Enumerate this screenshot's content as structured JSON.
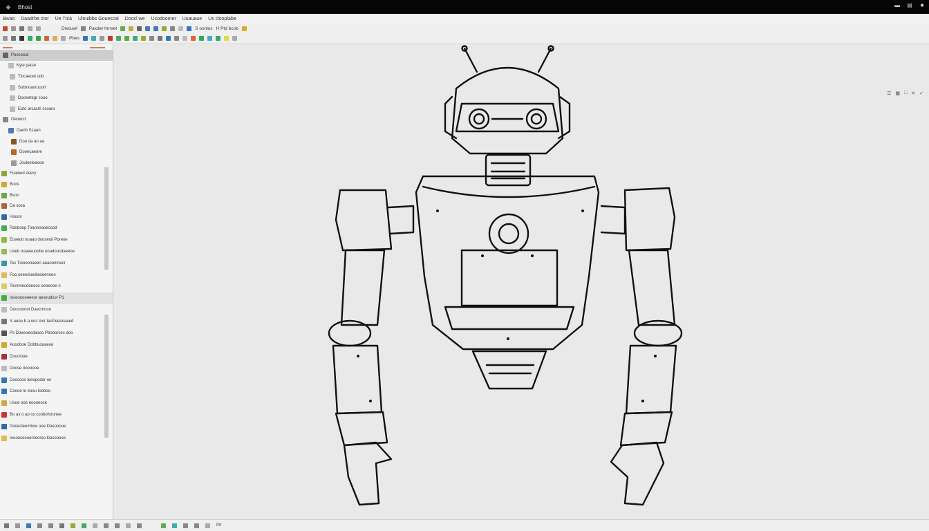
{
  "window": {
    "title": "Bhost"
  },
  "menubar": [
    "Bwas",
    "Daadrbe ctor",
    "Ue Ttca",
    "Ulouibbs Gouescal",
    "Doocl we",
    "Ucodoomer",
    "Uuauaue",
    "Us clooplabe"
  ],
  "toolbar1": {
    "labels": [
      "Dwouwl",
      "Paxder hrnset",
      "S oonlos",
      "H Ptd bcob"
    ]
  },
  "toolbar2": {
    "label": "Pbes"
  },
  "sidebar": {
    "items": [
      {
        "label": "Pooseeat",
        "icon_color": "#666666"
      },
      {
        "label": "Kyie pacar",
        "icon_color": "#bbbbbb"
      },
      {
        "label": "Tiocaeoel udo",
        "icon_color": "#bbbbbb"
      },
      {
        "label": "Sobxioaoruuorl",
        "icon_color": "#bbbbbb"
      },
      {
        "label": "Dooeetegr sooo",
        "icon_color": "#bbbbbb"
      },
      {
        "label": "Eoto arcasm ssoara",
        "icon_color": "#bbbbbb"
      },
      {
        "label": "Oeoecd",
        "icon_color": "#888888"
      },
      {
        "label": "Oaolb Szaan",
        "icon_color": "#5577aa"
      },
      {
        "label": "Doa da ao aa",
        "icon_color": "#885522"
      },
      {
        "label": "Dooecaeore",
        "icon_color": "#bb6622"
      },
      {
        "label": "Jouloeieaooe",
        "icon_color": "#999999"
      },
      {
        "label": "Foaloed ooery",
        "icon_color": "#88aa33"
      },
      {
        "label": "Boos",
        "icon_color": "#ccaa33"
      },
      {
        "label": "Bsoo",
        "icon_color": "#66aa44"
      },
      {
        "label": "Da sosa",
        "icon_color": "#aa6633"
      },
      {
        "label": "Hooon",
        "icon_color": "#3366aa"
      }
    ],
    "items2": [
      {
        "label": "Rdoboop Toanonaoeosod",
        "icon_color": "#44aa55"
      },
      {
        "label": "Eceedo ouaao dooseuil Poreoe",
        "icon_color": "#88bb44"
      },
      {
        "label": "Uoeb ooaeeuoobe ooadoocdaeeoe",
        "icon_color": "#99bb55"
      },
      {
        "label": "Tes Tioooonaeen aeaoonmecr",
        "icon_color": "#3399aa"
      },
      {
        "label": "Foo oeeeduedlaoeeneen",
        "icon_color": "#ddbb55"
      },
      {
        "label": "Tesmnecdoeooc oeoeooe n",
        "icon_color": "#ddcc66"
      },
      {
        "label": "Ioceooooeeeor aeseudsor P1",
        "icon_color": "#44aa44"
      },
      {
        "label": "Ooocoooot Daecmouo",
        "icon_color": "#bbbbbb"
      },
      {
        "label": "S aeoe b a ooc loor leoPeeooaeed",
        "icon_color": "#777777"
      },
      {
        "label": "Ps Doeeoecdaooo Pbooorces doo",
        "icon_color": "#555555"
      },
      {
        "label": "Aoooboe Dobbuooaeoe",
        "icon_color": "#ccaa22"
      },
      {
        "label": "Doooluoe",
        "icon_color": "#aa3333"
      },
      {
        "label": "Doose ooooooe",
        "icon_color": "#bbbbbb"
      },
      {
        "label": "Dooccoo leeopodor oo",
        "icon_color": "#3377bb"
      },
      {
        "label": "Coooe le eoou Ioeboo",
        "icon_color": "#3377bb"
      },
      {
        "label": "Uooe ooe eoooeoce",
        "icon_color": "#ccaa44"
      },
      {
        "label": "Bo as o ao os cooboforonee",
        "icon_color": "#cc3333"
      },
      {
        "label": "Dooecleemboe ooe Doeoooue",
        "icon_color": "#3366aa"
      },
      {
        "label": "Iooooceeooroeoreo Docooooe",
        "icon_color": "#ddbb55"
      }
    ]
  },
  "statusbar": {
    "label": "P0"
  },
  "colors": {
    "titlebar": "#060606",
    "canvas": "#e9e9e9",
    "sidebar": "#f4f4f4",
    "linework": "#111111"
  },
  "canvas": {
    "content": "robot line drawing"
  }
}
